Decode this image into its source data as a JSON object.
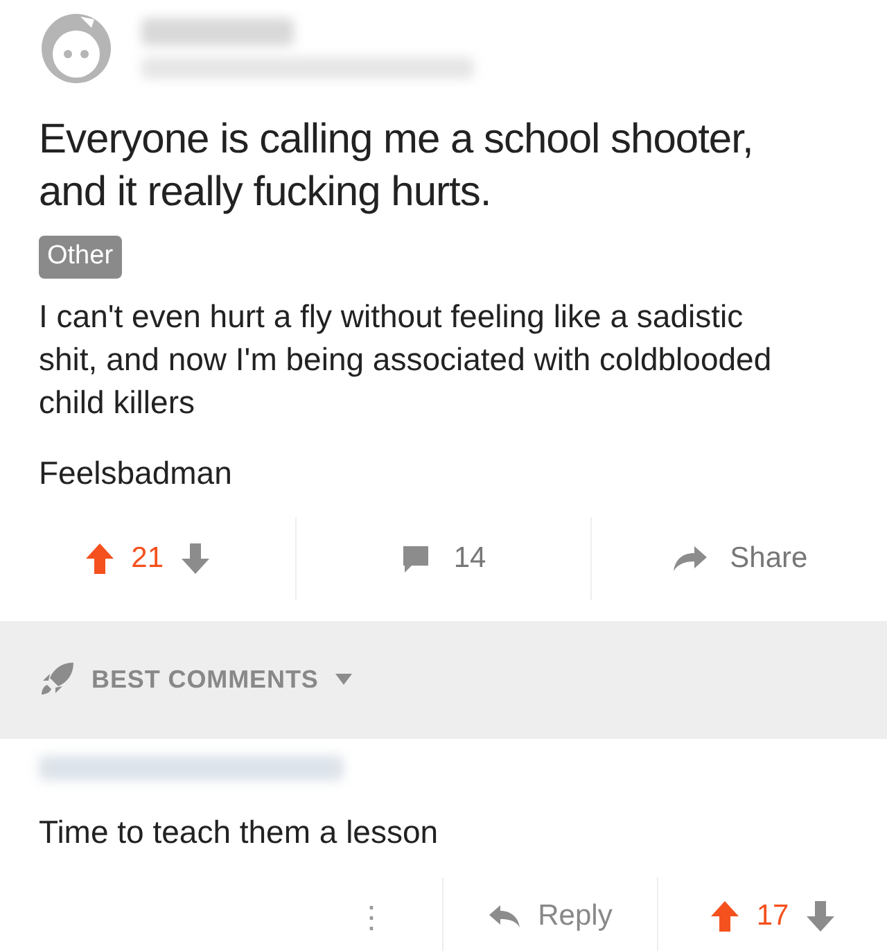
{
  "post": {
    "title": "Everyone is calling me a school shooter, and it really fucking hurts.",
    "flair": "Other",
    "body": [
      "I can't even hurt a fly without feeling like a sadistic shit, and now I'm being associated with coldblooded child killers",
      "Feelsbadman"
    ],
    "upvoted": true,
    "score": "21",
    "comments": "14",
    "share": "Share"
  },
  "sort": {
    "label": "BEST COMMENTS"
  },
  "comment": {
    "text": "Time to teach them a lesson",
    "menu": "⋮",
    "reply": "Reply",
    "upvoted": true,
    "score": "17"
  }
}
